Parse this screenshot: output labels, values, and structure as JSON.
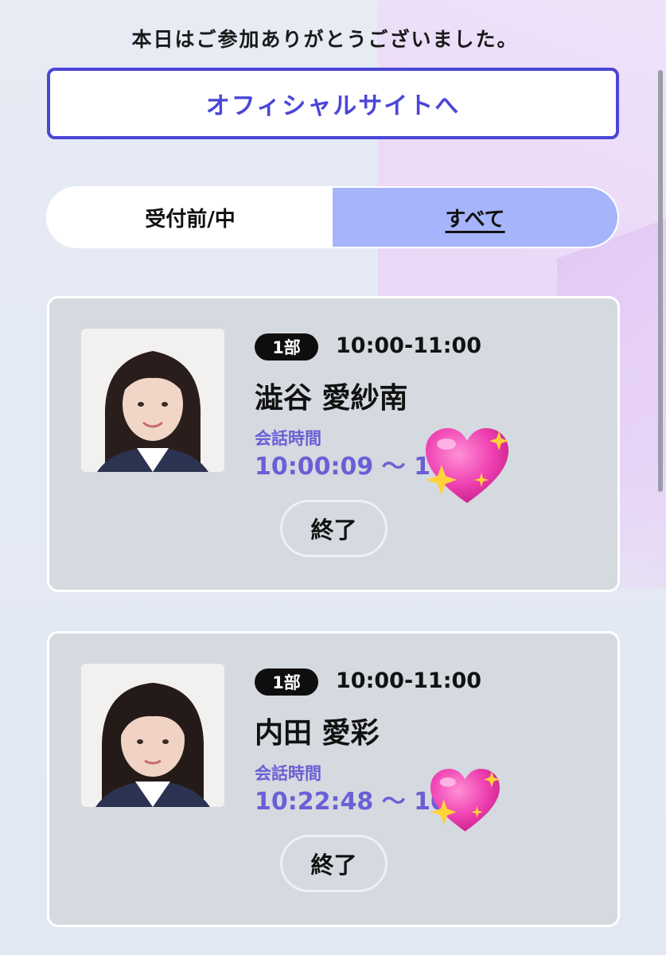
{
  "header": {
    "thanks_message": "本日はご参加ありがとうございました。",
    "official_site_button": "オフィシャルサイトへ"
  },
  "tabs": [
    {
      "label": "受付前/中",
      "active": false
    },
    {
      "label": "すべて",
      "active": true
    }
  ],
  "cards": [
    {
      "badge": "1部",
      "time_range": "10:00-11:00",
      "name": "澁谷 愛紗南",
      "talk_label": "会話時間",
      "talk_time": "10:00:09 ～ 10",
      "end_button": "終了",
      "sticker": "sparkling-heart"
    },
    {
      "badge": "1部",
      "time_range": "10:00-11:00",
      "name": "内田 愛彩",
      "talk_label": "会話時間",
      "talk_time": "10:22:48 ～ 10:",
      "end_button": "終了",
      "sticker": "sparkling-heart"
    }
  ],
  "colors": {
    "accent": "#4b46d6",
    "talk_text": "#6b5fd6",
    "active_tab": "#a6b4fb",
    "card_bg": "#d5d9e0",
    "badge_bg": "#0e0e0e"
  }
}
